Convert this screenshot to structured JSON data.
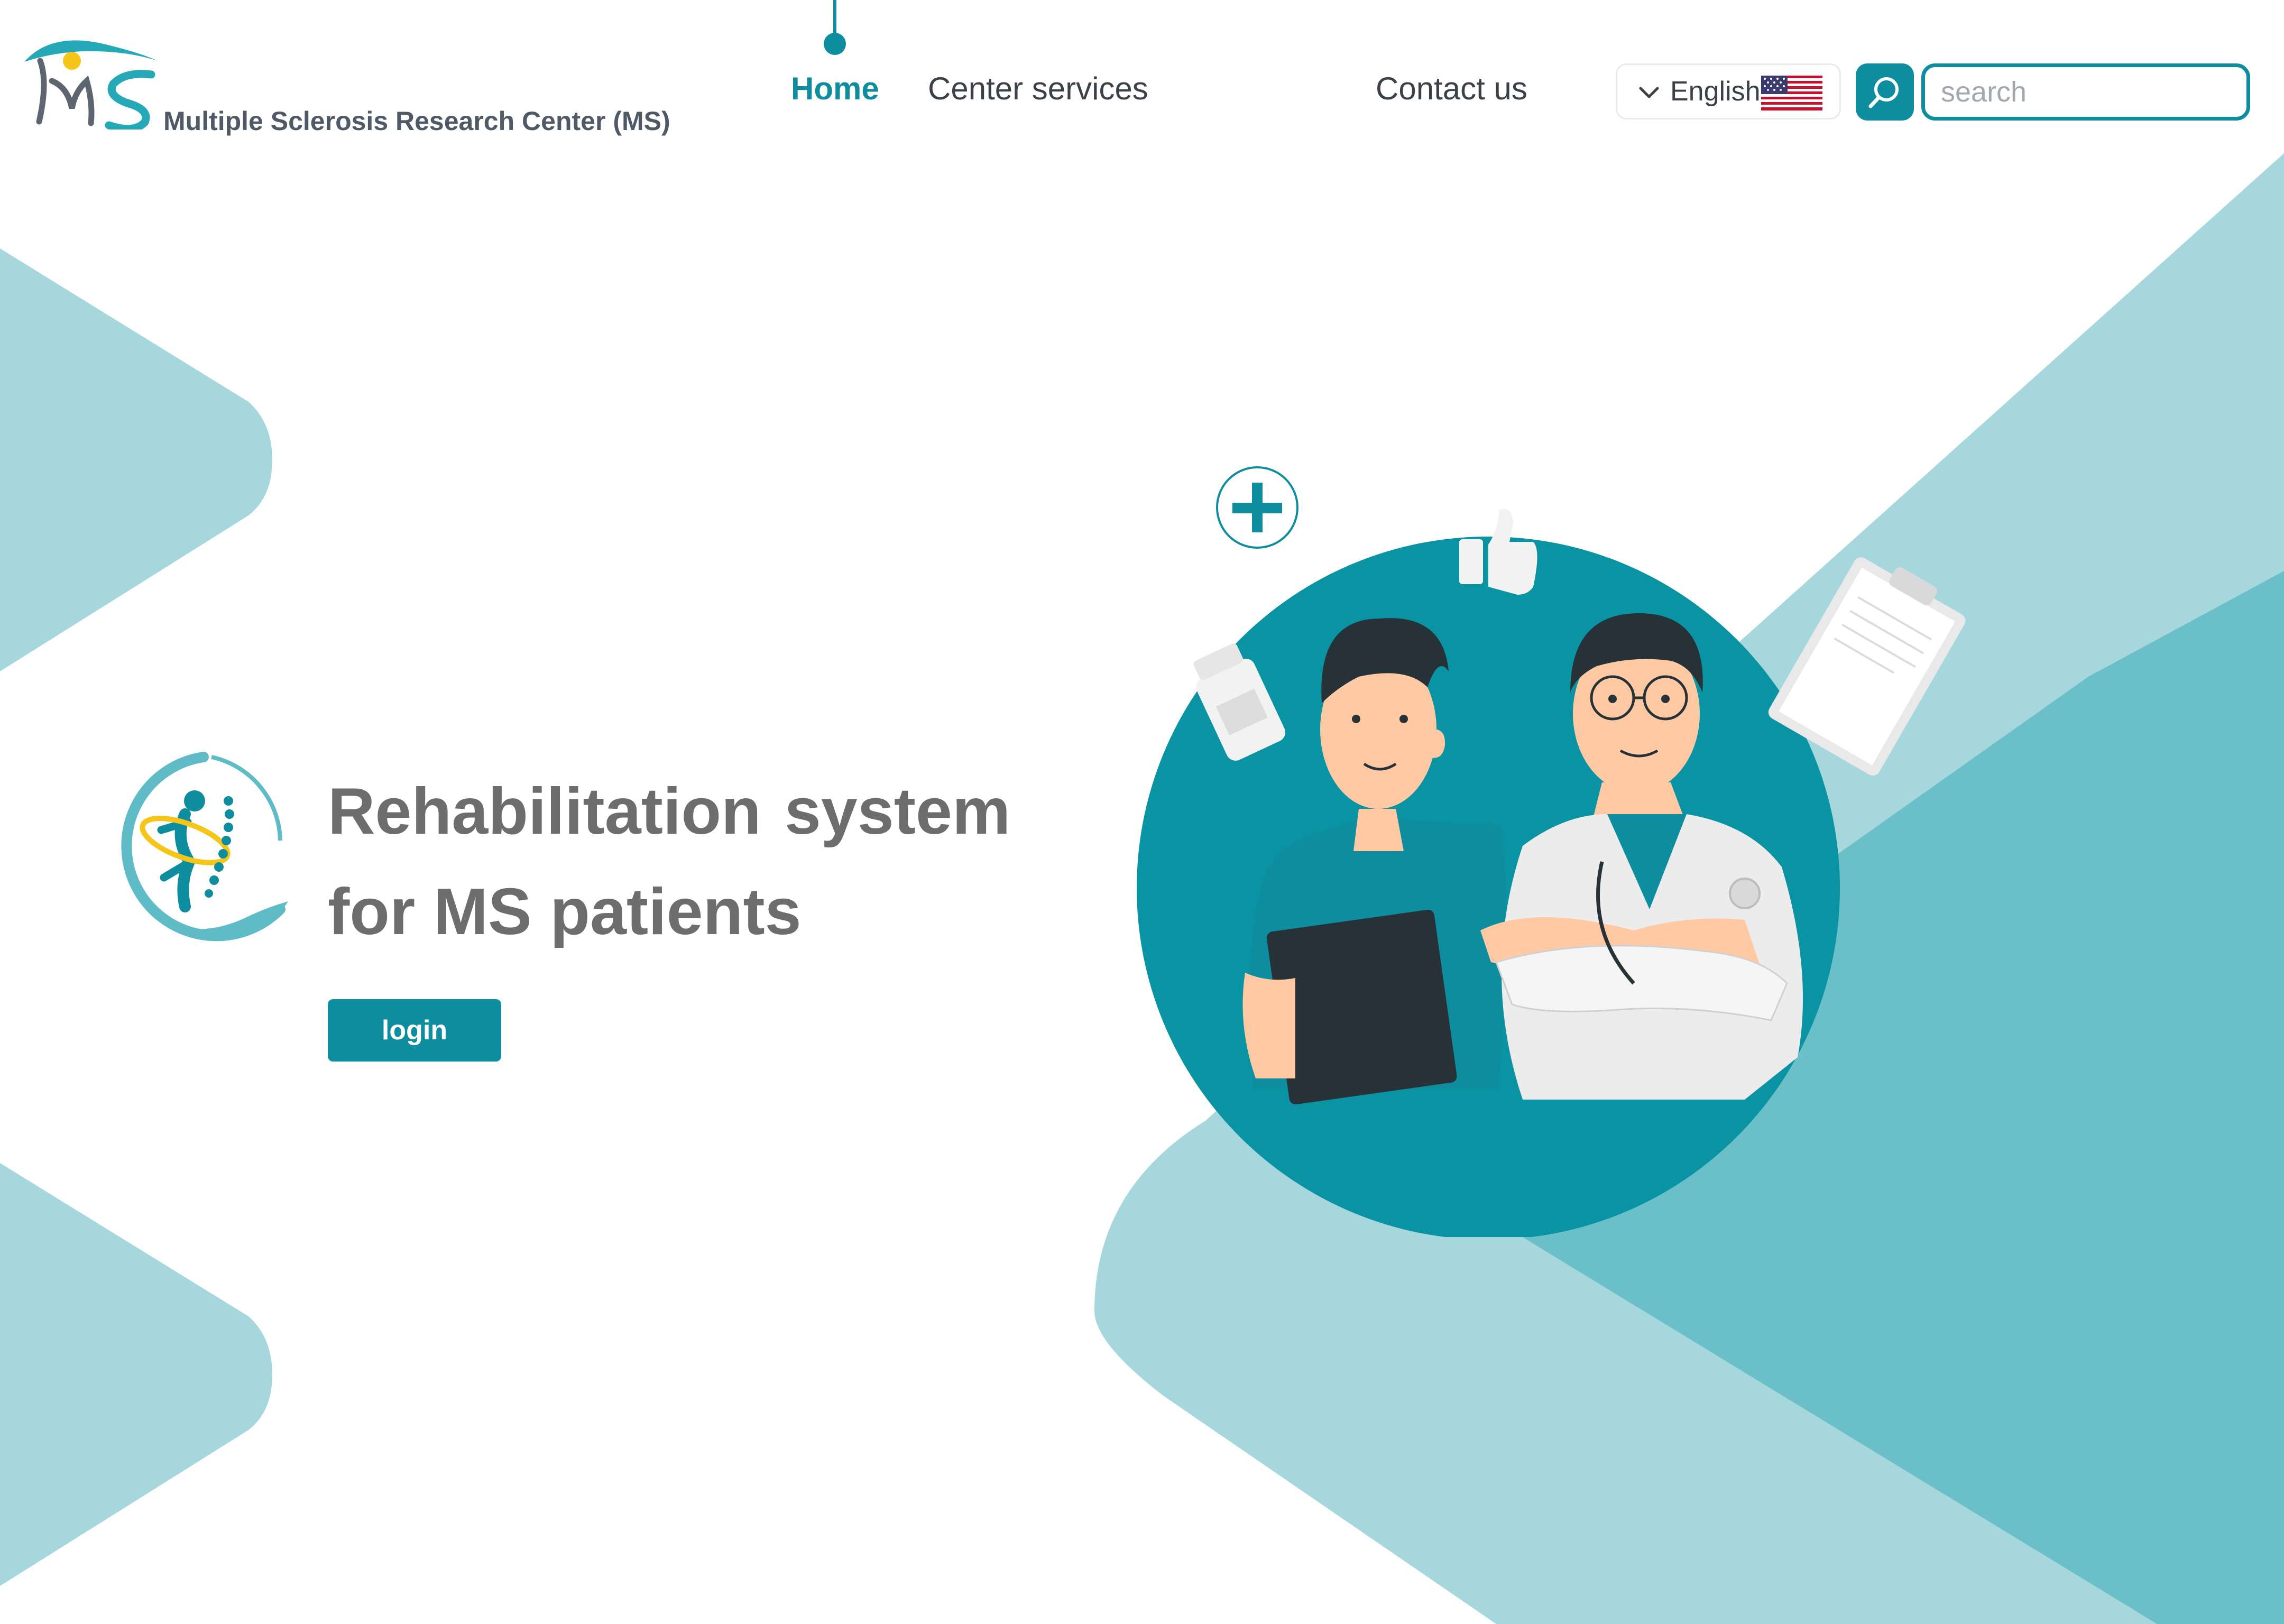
{
  "header": {
    "logo_text": "Multiple Sclerosis Research Center (MS)",
    "nav": {
      "home": "Home",
      "services": "Center services",
      "contact": "Contact us"
    },
    "language": {
      "label": "English",
      "flag": "us-flag-icon"
    },
    "search": {
      "placeholder": "search",
      "value": ""
    }
  },
  "hero": {
    "title_word_1": "Rehabilitation",
    "title_word_2": "system",
    "title_line_2": "for MS patients",
    "login_label": "login",
    "illustration": "two-doctors-illustration"
  },
  "colors": {
    "primary": "#0d8d9e",
    "accent_light": "#a5d7dd",
    "accent_mid": "#6bbfc8",
    "text_dark": "#3c4148",
    "title_gray": "#6d6d6d",
    "logo_yellow": "#f5c518"
  }
}
